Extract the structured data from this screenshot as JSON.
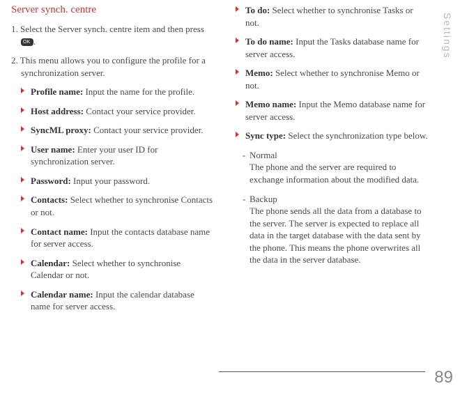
{
  "section_title": "Server synch. centre",
  "step1_prefix": "1. Select the Server synch. centre item and then press ",
  "step1_suffix": ".",
  "step2": "2. This menu allows you to configure the profile for a synchronization server.",
  "left_bullets": [
    {
      "label": "Profile name:",
      "text": " Input the name for the profile."
    },
    {
      "label": "Host address:",
      "text": " Contact your service provider."
    },
    {
      "label": "SyncML proxy:",
      "text": " Contact your service provider."
    },
    {
      "label": "User name:",
      "text": " Enter your user ID for synchronization server."
    },
    {
      "label": "Password:",
      "text": " Input your password."
    },
    {
      "label": "Contacts:",
      "text": " Select whether to synchronise Contacts or not."
    },
    {
      "label": "Contact name:",
      "text": " Input the contacts database name for server access."
    },
    {
      "label": "Calendar:",
      "text": " Select whether to synchronise Calendar or not."
    },
    {
      "label": "Calendar name:",
      "text": " Input the calendar database name for server access."
    }
  ],
  "right_bullets": [
    {
      "label": "To do:",
      "text": " Select whether to synchronise Tasks or not."
    },
    {
      "label": "To do name:",
      "text": " Input the Tasks database name for server access."
    },
    {
      "label": "Memo:",
      "text": " Select whether to synchronise Memo or not."
    },
    {
      "label": "Memo name:",
      "text": " Input the Memo database name for server access."
    },
    {
      "label": "Sync type:",
      "text": " Select the synchronization type below."
    }
  ],
  "sub_items": [
    {
      "marker": "-",
      "title": "Normal",
      "body": "The phone and the server are required to exchange information about the modified data."
    },
    {
      "marker": "-",
      "title": "Backup",
      "body": "The phone sends all the data from a database to the server. The server is expected to replace all data in the target database with the data sent by the phone. This means the phone overwrites all the data in the server database."
    }
  ],
  "vertical_label": "Settings",
  "page_number": "89"
}
